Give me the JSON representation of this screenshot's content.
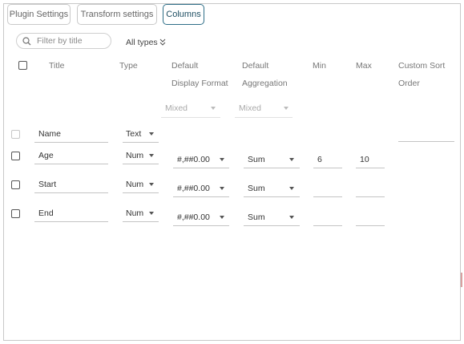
{
  "tabs": [
    {
      "label": "Plugin Settings",
      "active": false
    },
    {
      "label": "Transform settings",
      "active": false
    },
    {
      "label": "Columns",
      "active": true
    }
  ],
  "filter": {
    "placeholder": "Filter by title",
    "type_label": "All types",
    "type_icon": "double-chevron-down-icon"
  },
  "columns_header": {
    "title": "Title",
    "type": "Type",
    "default_display_format": [
      "Default",
      "Display Format"
    ],
    "default_aggregation": [
      "Default",
      "Aggregation"
    ],
    "min": "Min",
    "max": "Max",
    "custom_sort_order": [
      "Custom Sort",
      "Order"
    ]
  },
  "bulk_row": {
    "display_format": "Mixed",
    "aggregation": "Mixed"
  },
  "rows": [
    {
      "title": "Name",
      "type": "Text",
      "format": "",
      "aggregation": "",
      "min": "",
      "max": "",
      "enabled": false
    },
    {
      "title": "Age",
      "type": "Num",
      "format": "#,##0.00",
      "aggregation": "Sum",
      "min": "6",
      "max": "10",
      "enabled": true
    },
    {
      "title": "Start",
      "type": "Num",
      "format": "#,##0.00",
      "aggregation": "Sum",
      "min": "",
      "max": "",
      "enabled": true
    },
    {
      "title": "End",
      "type": "Num",
      "format": "#,##0.00",
      "aggregation": "Sum",
      "min": "",
      "max": "",
      "enabled": true
    }
  ],
  "colors": {
    "active_tab_border": "#2f6f88",
    "border": "#c8c8c8",
    "muted_text": "#aaaaaa"
  }
}
